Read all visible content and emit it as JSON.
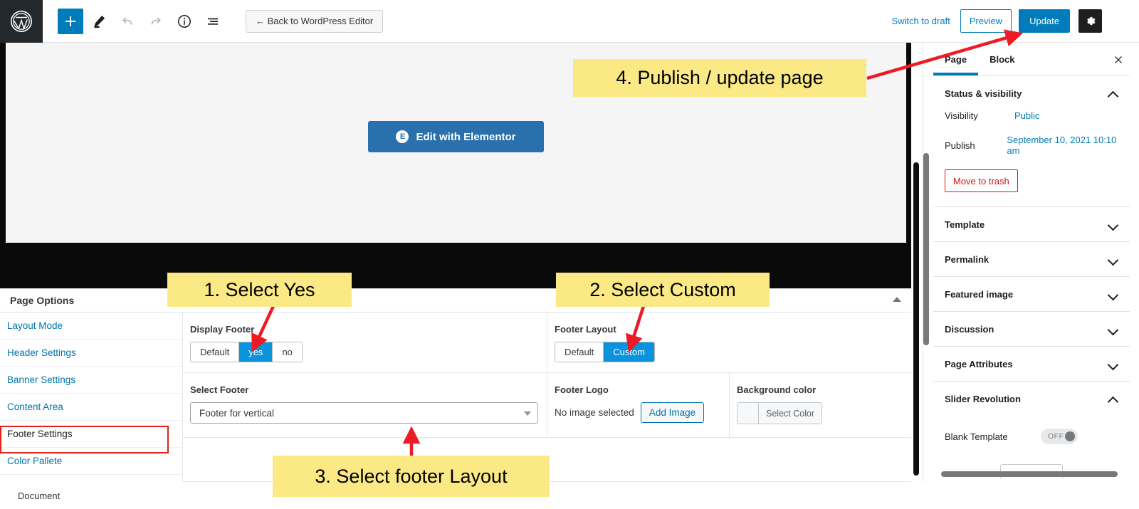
{
  "topbar": {
    "logo_icon": "wordpress-logo-icon",
    "tools": [
      {
        "name": "add-block-button",
        "icon": "plus-icon",
        "label": "+"
      },
      {
        "name": "edit-tool-button",
        "icon": "pencil-icon",
        "label": ""
      },
      {
        "name": "undo-button",
        "icon": "undo-arrow-icon",
        "label": ""
      },
      {
        "name": "redo-button",
        "icon": "redo-arrow-icon",
        "label": ""
      },
      {
        "name": "details-button",
        "icon": "info-circle-icon",
        "label": ""
      },
      {
        "name": "list-view-button",
        "icon": "list-view-icon",
        "label": ""
      }
    ],
    "back_button": "← Back to WordPress Editor",
    "switch_to_draft": "Switch to draft",
    "preview": "Preview",
    "update": "Update",
    "settings_icon": "gear-icon",
    "more_icon": "kebab-menu-icon",
    "accent_color": "#007cba"
  },
  "canvas": {
    "elementor_button": "Edit with Elementor",
    "elementor_badge": "E",
    "elementor_color": "#2a70ad"
  },
  "metabox": {
    "title": "Page Options",
    "collapse_icon": "collapse-triangle-icon",
    "nav": [
      {
        "label": "Layout Mode",
        "active": false
      },
      {
        "label": "Header Settings",
        "active": false
      },
      {
        "label": "Banner Settings",
        "active": false
      },
      {
        "label": "Content Area",
        "active": false
      },
      {
        "label": "Footer Settings",
        "active": true
      },
      {
        "label": "Color Pallete",
        "active": false
      }
    ],
    "display_footer": {
      "label": "Display Footer",
      "options": [
        "Default",
        "yes",
        "no"
      ],
      "selected": "yes"
    },
    "footer_layout": {
      "label": "Footer Layout",
      "options": [
        "Default",
        "Custom"
      ],
      "selected": "Custom"
    },
    "select_footer": {
      "label": "Select Footer",
      "value": "Footer for vertical",
      "caret_icon": "chevron-down-icon"
    },
    "footer_logo": {
      "label": "Footer Logo",
      "status": "No image selected",
      "button": "Add Image"
    },
    "background_color": {
      "label": "Background color",
      "button": "Select Color",
      "swatch": "#f7f8f9"
    },
    "document_label": "Document",
    "selected_color": "#0a92dd",
    "highlight_outline_color": "#e2231a"
  },
  "sidebar": {
    "tabs": [
      {
        "label": "Page",
        "active": true
      },
      {
        "label": "Block",
        "active": false
      }
    ],
    "close_icon": "close-x-icon",
    "status_visibility": {
      "title": "Status & visibility",
      "expanded": true,
      "rows": [
        {
          "label": "Visibility",
          "value": "Public"
        },
        {
          "label": "Publish",
          "value": "September 10, 2021 10:10 am"
        }
      ],
      "trash_button": "Move to trash",
      "trash_color": "#cc1818"
    },
    "sections": [
      {
        "title": "Template",
        "expanded": false
      },
      {
        "title": "Permalink",
        "expanded": false
      },
      {
        "title": "Featured image",
        "expanded": false
      },
      {
        "title": "Discussion",
        "expanded": false
      },
      {
        "title": "Page Attributes",
        "expanded": false
      }
    ],
    "slider_revolution": {
      "title": "Slider Revolution",
      "expanded": true,
      "toggle_label": "Blank Template",
      "toggle_state": "OFF"
    }
  },
  "annotations": {
    "step1": "1. Select Yes",
    "step2": "2. Select Custom",
    "step3": "3. Select footer Layout",
    "step4": "4. Publish / update page",
    "highlight_color": "#fbe985",
    "arrow_color": "#ee1b24"
  }
}
